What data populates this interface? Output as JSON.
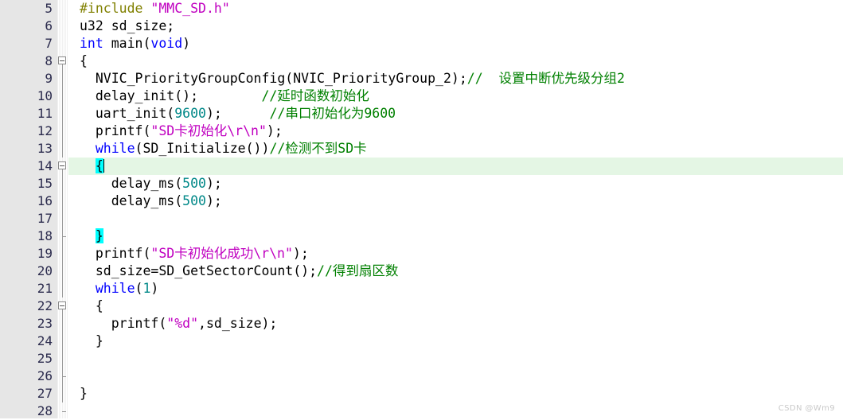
{
  "editor": {
    "name": "c-source-code-editor",
    "language": "C",
    "first_visible_line": 5,
    "last_visible_line": 28,
    "current_line": 14,
    "colors": {
      "background": "#ffffff",
      "gutter_background": "#e6e6e6",
      "gutter_text": "#2b2b4d",
      "current_line_highlight": "#e4f6e4",
      "brace_match_highlight": "#00ffff",
      "preprocessor": "#808000",
      "string": "#c000c0",
      "keyword": "#0000ff",
      "number": "#008888",
      "comment": "#008000",
      "plain_text": "#000000",
      "fold_line": "#9a9a9a"
    }
  },
  "watermark": {
    "text": "CSDN @Wm9"
  },
  "lines": [
    {
      "number": "5",
      "fold": "none",
      "current": false,
      "tokens": [
        {
          "t": "pre",
          "v": "#include"
        },
        {
          "t": "plain",
          "v": " "
        },
        {
          "t": "str",
          "v": "\"MMC_SD.h\""
        }
      ]
    },
    {
      "number": "6",
      "fold": "none",
      "current": false,
      "tokens": [
        {
          "t": "plain",
          "v": "u32 sd_size;"
        }
      ]
    },
    {
      "number": "7",
      "fold": "none",
      "current": false,
      "tokens": [
        {
          "t": "kw",
          "v": "int"
        },
        {
          "t": "plain",
          "v": " main("
        },
        {
          "t": "kw",
          "v": "void"
        },
        {
          "t": "plain",
          "v": ")"
        }
      ]
    },
    {
      "number": "8",
      "fold": "box",
      "current": false,
      "tokens": [
        {
          "t": "plain",
          "v": "{"
        }
      ]
    },
    {
      "number": "9",
      "fold": "line",
      "current": false,
      "tokens": [
        {
          "t": "plain",
          "v": "  NVIC_PriorityGroupConfig(NVIC_PriorityGroup_2);"
        },
        {
          "t": "com",
          "v": "//  设置中断优先级分组2"
        }
      ]
    },
    {
      "number": "10",
      "fold": "line",
      "current": false,
      "tokens": [
        {
          "t": "plain",
          "v": "  delay_init();        "
        },
        {
          "t": "com",
          "v": "//延时函数初始化"
        }
      ]
    },
    {
      "number": "11",
      "fold": "line",
      "current": false,
      "tokens": [
        {
          "t": "plain",
          "v": "  uart_init("
        },
        {
          "t": "num",
          "v": "9600"
        },
        {
          "t": "plain",
          "v": ");      "
        },
        {
          "t": "com",
          "v": "//串口初始化为9600"
        }
      ]
    },
    {
      "number": "12",
      "fold": "line",
      "current": false,
      "tokens": [
        {
          "t": "plain",
          "v": "  printf("
        },
        {
          "t": "str",
          "v": "\"SD卡初始化\\r\\n\""
        },
        {
          "t": "plain",
          "v": ");"
        }
      ]
    },
    {
      "number": "13",
      "fold": "line",
      "current": false,
      "tokens": [
        {
          "t": "plain",
          "v": "  "
        },
        {
          "t": "kw",
          "v": "while"
        },
        {
          "t": "plain",
          "v": "(SD_Initialize())"
        },
        {
          "t": "com",
          "v": "//检测不到SD卡"
        }
      ]
    },
    {
      "number": "14",
      "fold": "box",
      "current": true,
      "tokens": [
        {
          "t": "plain",
          "v": "  "
        },
        {
          "t": "brace",
          "v": "{"
        },
        {
          "t": "caret",
          "v": ""
        }
      ]
    },
    {
      "number": "15",
      "fold": "line",
      "current": false,
      "tokens": [
        {
          "t": "plain",
          "v": "    delay_ms("
        },
        {
          "t": "num",
          "v": "500"
        },
        {
          "t": "plain",
          "v": ");"
        }
      ]
    },
    {
      "number": "16",
      "fold": "line",
      "current": false,
      "tokens": [
        {
          "t": "plain",
          "v": "    delay_ms("
        },
        {
          "t": "num",
          "v": "500"
        },
        {
          "t": "plain",
          "v": ");"
        }
      ]
    },
    {
      "number": "17",
      "fold": "line",
      "current": false,
      "tokens": []
    },
    {
      "number": "18",
      "fold": "tick",
      "current": false,
      "tokens": [
        {
          "t": "plain",
          "v": "  "
        },
        {
          "t": "brace",
          "v": "}"
        }
      ]
    },
    {
      "number": "19",
      "fold": "line",
      "current": false,
      "tokens": [
        {
          "t": "plain",
          "v": "  printf("
        },
        {
          "t": "str",
          "v": "\"SD卡初始化成功\\r\\n\""
        },
        {
          "t": "plain",
          "v": ");"
        }
      ]
    },
    {
      "number": "20",
      "fold": "line",
      "current": false,
      "tokens": [
        {
          "t": "plain",
          "v": "  sd_size=SD_GetSectorCount();"
        },
        {
          "t": "com",
          "v": "//得到扇区数"
        }
      ]
    },
    {
      "number": "21",
      "fold": "line",
      "current": false,
      "tokens": [
        {
          "t": "plain",
          "v": "  "
        },
        {
          "t": "kw",
          "v": "while"
        },
        {
          "t": "plain",
          "v": "("
        },
        {
          "t": "num",
          "v": "1"
        },
        {
          "t": "plain",
          "v": ")"
        }
      ]
    },
    {
      "number": "22",
      "fold": "box",
      "current": false,
      "tokens": [
        {
          "t": "plain",
          "v": "  {"
        }
      ]
    },
    {
      "number": "23",
      "fold": "line",
      "current": false,
      "tokens": [
        {
          "t": "plain",
          "v": "    printf("
        },
        {
          "t": "str",
          "v": "\"%d\""
        },
        {
          "t": "plain",
          "v": ",sd_size);"
        }
      ]
    },
    {
      "number": "24",
      "fold": "line",
      "current": false,
      "tokens": [
        {
          "t": "plain",
          "v": "  }"
        }
      ]
    },
    {
      "number": "25",
      "fold": "line",
      "current": false,
      "tokens": []
    },
    {
      "number": "26",
      "fold": "tick",
      "current": false,
      "tokens": []
    },
    {
      "number": "27",
      "fold": "line",
      "current": false,
      "tokens": [
        {
          "t": "plain",
          "v": "}"
        }
      ]
    },
    {
      "number": "28",
      "fold": "end",
      "current": false,
      "tokens": []
    }
  ]
}
